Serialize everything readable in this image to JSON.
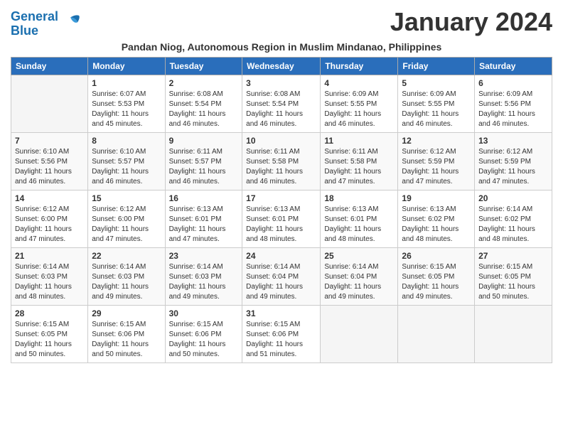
{
  "logo": {
    "line1": "General",
    "line2": "Blue"
  },
  "title": "January 2024",
  "subtitle": "Pandan Niog, Autonomous Region in Muslim Mindanao, Philippines",
  "headers": [
    "Sunday",
    "Monday",
    "Tuesday",
    "Wednesday",
    "Thursday",
    "Friday",
    "Saturday"
  ],
  "weeks": [
    [
      {
        "day": "",
        "sunrise": "",
        "sunset": "",
        "daylight": ""
      },
      {
        "day": "1",
        "sunrise": "Sunrise: 6:07 AM",
        "sunset": "Sunset: 5:53 PM",
        "daylight": "Daylight: 11 hours and 45 minutes."
      },
      {
        "day": "2",
        "sunrise": "Sunrise: 6:08 AM",
        "sunset": "Sunset: 5:54 PM",
        "daylight": "Daylight: 11 hours and 46 minutes."
      },
      {
        "day": "3",
        "sunrise": "Sunrise: 6:08 AM",
        "sunset": "Sunset: 5:54 PM",
        "daylight": "Daylight: 11 hours and 46 minutes."
      },
      {
        "day": "4",
        "sunrise": "Sunrise: 6:09 AM",
        "sunset": "Sunset: 5:55 PM",
        "daylight": "Daylight: 11 hours and 46 minutes."
      },
      {
        "day": "5",
        "sunrise": "Sunrise: 6:09 AM",
        "sunset": "Sunset: 5:55 PM",
        "daylight": "Daylight: 11 hours and 46 minutes."
      },
      {
        "day": "6",
        "sunrise": "Sunrise: 6:09 AM",
        "sunset": "Sunset: 5:56 PM",
        "daylight": "Daylight: 11 hours and 46 minutes."
      }
    ],
    [
      {
        "day": "7",
        "sunrise": "Sunrise: 6:10 AM",
        "sunset": "Sunset: 5:56 PM",
        "daylight": "Daylight: 11 hours and 46 minutes."
      },
      {
        "day": "8",
        "sunrise": "Sunrise: 6:10 AM",
        "sunset": "Sunset: 5:57 PM",
        "daylight": "Daylight: 11 hours and 46 minutes."
      },
      {
        "day": "9",
        "sunrise": "Sunrise: 6:11 AM",
        "sunset": "Sunset: 5:57 PM",
        "daylight": "Daylight: 11 hours and 46 minutes."
      },
      {
        "day": "10",
        "sunrise": "Sunrise: 6:11 AM",
        "sunset": "Sunset: 5:58 PM",
        "daylight": "Daylight: 11 hours and 46 minutes."
      },
      {
        "day": "11",
        "sunrise": "Sunrise: 6:11 AM",
        "sunset": "Sunset: 5:58 PM",
        "daylight": "Daylight: 11 hours and 47 minutes."
      },
      {
        "day": "12",
        "sunrise": "Sunrise: 6:12 AM",
        "sunset": "Sunset: 5:59 PM",
        "daylight": "Daylight: 11 hours and 47 minutes."
      },
      {
        "day": "13",
        "sunrise": "Sunrise: 6:12 AM",
        "sunset": "Sunset: 5:59 PM",
        "daylight": "Daylight: 11 hours and 47 minutes."
      }
    ],
    [
      {
        "day": "14",
        "sunrise": "Sunrise: 6:12 AM",
        "sunset": "Sunset: 6:00 PM",
        "daylight": "Daylight: 11 hours and 47 minutes."
      },
      {
        "day": "15",
        "sunrise": "Sunrise: 6:12 AM",
        "sunset": "Sunset: 6:00 PM",
        "daylight": "Daylight: 11 hours and 47 minutes."
      },
      {
        "day": "16",
        "sunrise": "Sunrise: 6:13 AM",
        "sunset": "Sunset: 6:01 PM",
        "daylight": "Daylight: 11 hours and 47 minutes."
      },
      {
        "day": "17",
        "sunrise": "Sunrise: 6:13 AM",
        "sunset": "Sunset: 6:01 PM",
        "daylight": "Daylight: 11 hours and 48 minutes."
      },
      {
        "day": "18",
        "sunrise": "Sunrise: 6:13 AM",
        "sunset": "Sunset: 6:01 PM",
        "daylight": "Daylight: 11 hours and 48 minutes."
      },
      {
        "day": "19",
        "sunrise": "Sunrise: 6:13 AM",
        "sunset": "Sunset: 6:02 PM",
        "daylight": "Daylight: 11 hours and 48 minutes."
      },
      {
        "day": "20",
        "sunrise": "Sunrise: 6:14 AM",
        "sunset": "Sunset: 6:02 PM",
        "daylight": "Daylight: 11 hours and 48 minutes."
      }
    ],
    [
      {
        "day": "21",
        "sunrise": "Sunrise: 6:14 AM",
        "sunset": "Sunset: 6:03 PM",
        "daylight": "Daylight: 11 hours and 48 minutes."
      },
      {
        "day": "22",
        "sunrise": "Sunrise: 6:14 AM",
        "sunset": "Sunset: 6:03 PM",
        "daylight": "Daylight: 11 hours and 49 minutes."
      },
      {
        "day": "23",
        "sunrise": "Sunrise: 6:14 AM",
        "sunset": "Sunset: 6:03 PM",
        "daylight": "Daylight: 11 hours and 49 minutes."
      },
      {
        "day": "24",
        "sunrise": "Sunrise: 6:14 AM",
        "sunset": "Sunset: 6:04 PM",
        "daylight": "Daylight: 11 hours and 49 minutes."
      },
      {
        "day": "25",
        "sunrise": "Sunrise: 6:14 AM",
        "sunset": "Sunset: 6:04 PM",
        "daylight": "Daylight: 11 hours and 49 minutes."
      },
      {
        "day": "26",
        "sunrise": "Sunrise: 6:15 AM",
        "sunset": "Sunset: 6:05 PM",
        "daylight": "Daylight: 11 hours and 49 minutes."
      },
      {
        "day": "27",
        "sunrise": "Sunrise: 6:15 AM",
        "sunset": "Sunset: 6:05 PM",
        "daylight": "Daylight: 11 hours and 50 minutes."
      }
    ],
    [
      {
        "day": "28",
        "sunrise": "Sunrise: 6:15 AM",
        "sunset": "Sunset: 6:05 PM",
        "daylight": "Daylight: 11 hours and 50 minutes."
      },
      {
        "day": "29",
        "sunrise": "Sunrise: 6:15 AM",
        "sunset": "Sunset: 6:06 PM",
        "daylight": "Daylight: 11 hours and 50 minutes."
      },
      {
        "day": "30",
        "sunrise": "Sunrise: 6:15 AM",
        "sunset": "Sunset: 6:06 PM",
        "daylight": "Daylight: 11 hours and 50 minutes."
      },
      {
        "day": "31",
        "sunrise": "Sunrise: 6:15 AM",
        "sunset": "Sunset: 6:06 PM",
        "daylight": "Daylight: 11 hours and 51 minutes."
      },
      {
        "day": "",
        "sunrise": "",
        "sunset": "",
        "daylight": ""
      },
      {
        "day": "",
        "sunrise": "",
        "sunset": "",
        "daylight": ""
      },
      {
        "day": "",
        "sunrise": "",
        "sunset": "",
        "daylight": ""
      }
    ]
  ]
}
